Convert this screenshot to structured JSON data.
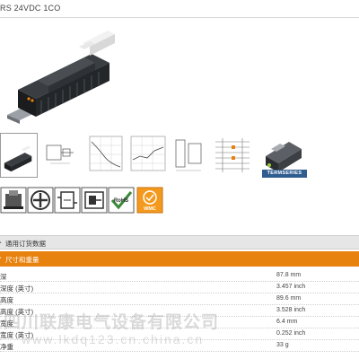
{
  "product": {
    "title": "RS 24VDC 1CO"
  },
  "gallery": {
    "termseries_label": "TERMSERIES"
  },
  "certifications": [
    {
      "icon": "terminal-icon"
    },
    {
      "icon": "plus-symbol-icon"
    },
    {
      "icon": "relay-module-icon"
    },
    {
      "icon": "circuit-icon"
    },
    {
      "icon": "rohs-compliant-icon"
    },
    {
      "icon": "wmc-icon"
    }
  ],
  "sections": {
    "ordering_label": "通用订货数据",
    "dimensions_label": "尺寸和重量"
  },
  "dimensions": [
    {
      "label": "深",
      "value": "87.8 mm"
    },
    {
      "label": "深度 (英寸)",
      "value": "3.457 inch"
    },
    {
      "label": "高度",
      "value": "89.6 mm"
    },
    {
      "label": "高度 (英寸)",
      "value": "3.528 inch"
    },
    {
      "label": "宽度",
      "value": "6.4 mm"
    },
    {
      "label": "宽度 (英寸)",
      "value": "0.252 inch"
    },
    {
      "label": "净重",
      "value": "33 g"
    }
  ],
  "watermark": {
    "line1": "四川联康电气设备有限公司",
    "line2": "www.lkdq123.cn.china.cn"
  },
  "colors": {
    "accent_orange": "#e8820f",
    "termseries_blue": "#2f5d8f",
    "rohs_green": "#3a8a3a",
    "wmc_orange": "#f39a1e"
  }
}
